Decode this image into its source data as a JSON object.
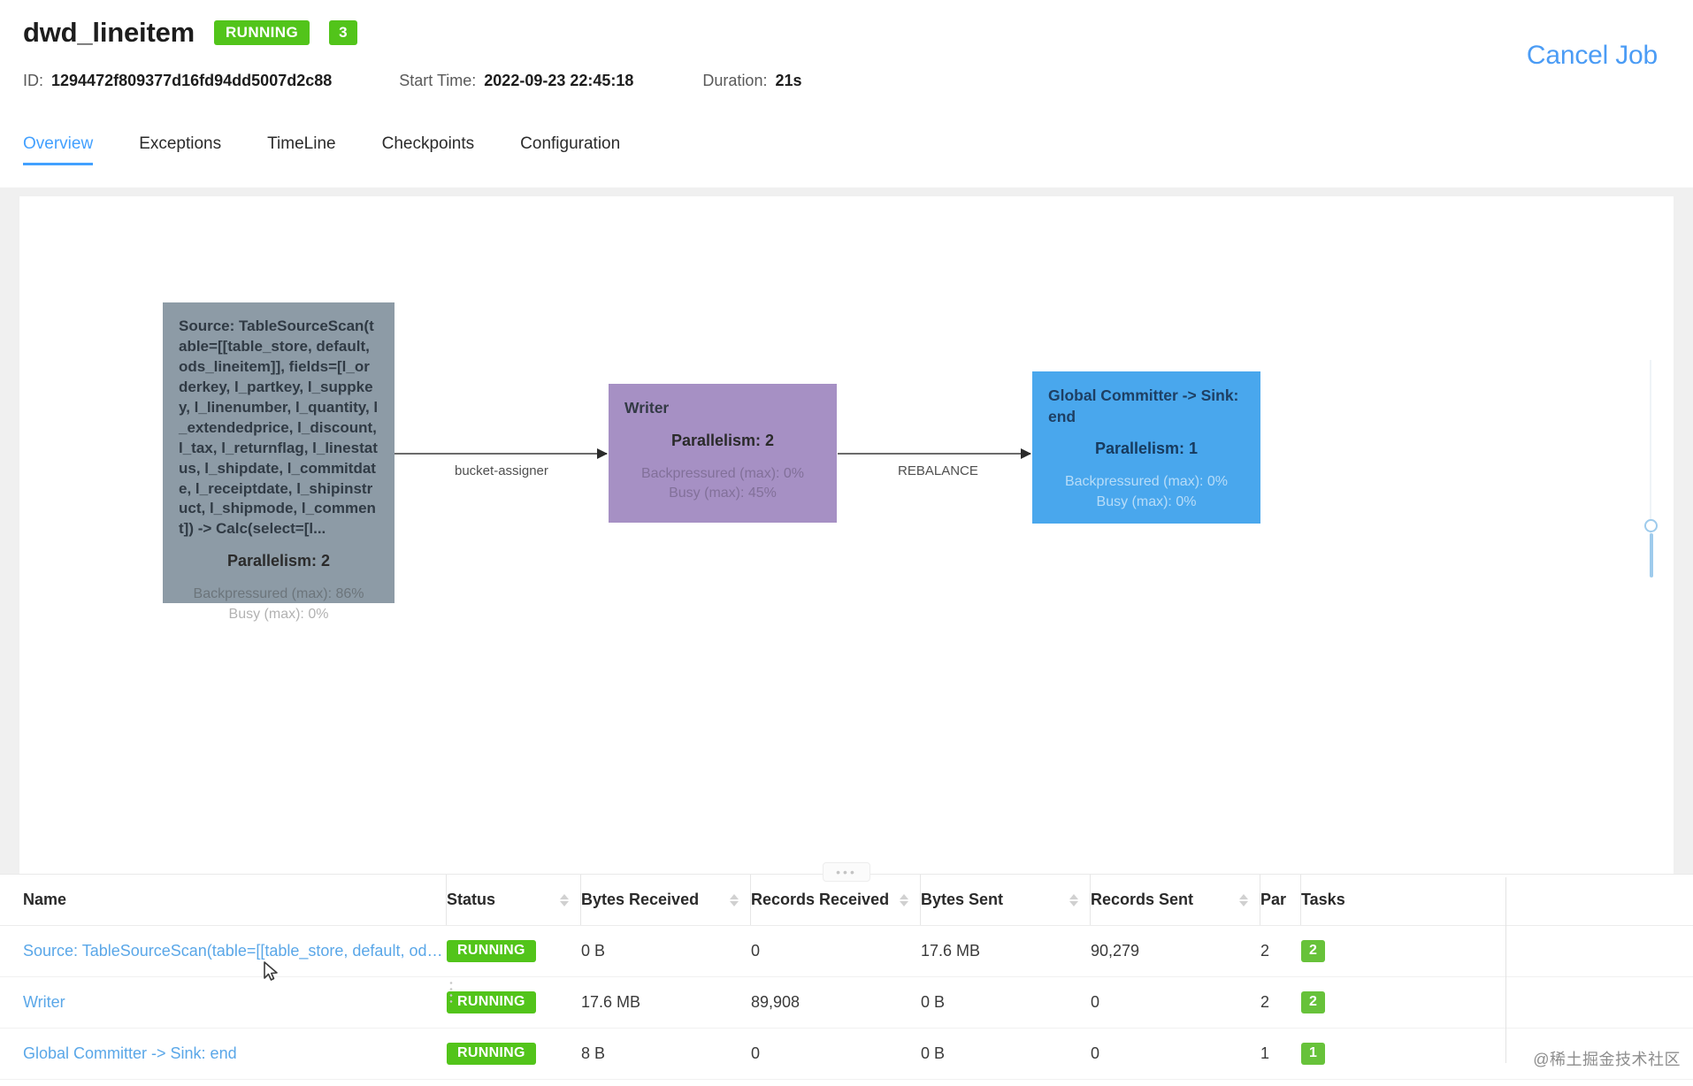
{
  "header": {
    "job_name": "dwd_lineitem",
    "status_badge": "RUNNING",
    "count_badge": "3",
    "id_label": "ID:",
    "id_value": "1294472f809377d16fd94dd5007d2c88",
    "start_time_label": "Start Time:",
    "start_time_value": "2022-09-23 22:45:18",
    "duration_label": "Duration:",
    "duration_value": "21s",
    "cancel_job": "Cancel Job",
    "accent_color": "#42a0ff",
    "status_color": "#52c41a"
  },
  "tabs": [
    {
      "label": "Overview",
      "active": true
    },
    {
      "label": "Exceptions",
      "active": false
    },
    {
      "label": "TimeLine",
      "active": false
    },
    {
      "label": "Checkpoints",
      "active": false
    },
    {
      "label": "Configuration",
      "active": false
    }
  ],
  "graph": {
    "nodes": [
      {
        "id": "source",
        "title": "Source: TableSourceScan(table=[[table_store, default, ods_lineitem]], fields=[l_orderkey, l_partkey, l_suppkey, l_linenumber, l_quantity, l_extendedprice, l_discount, l_tax, l_returnflag, l_linestatus, l_shipdate, l_commitdate, l_receiptdate, l_shipinstruct, l_shipmode, l_comment]) -> Calc(select=[l...",
        "parallelism": "Parallelism: 2",
        "backpressured": "Backpressured (max): 86%",
        "busy": "Busy (max): 0%",
        "color": "#8d9ba6"
      },
      {
        "id": "writer",
        "title": "Writer",
        "parallelism": "Parallelism: 2",
        "backpressured": "Backpressured (max): 0%",
        "busy": "Busy (max): 45%",
        "color": "#a690c4"
      },
      {
        "id": "sink",
        "title": "Global Committer -> Sink: end",
        "parallelism": "Parallelism: 1",
        "backpressured": "Backpressured (max): 0%",
        "busy": "Busy (max): 0%",
        "color": "#49a7ed"
      }
    ],
    "edges": [
      {
        "label": "bucket-assigner"
      },
      {
        "label": "REBALANCE"
      }
    ],
    "zoom_slider": {
      "name": "zoom-slider"
    }
  },
  "table": {
    "columns": [
      {
        "key": "name",
        "label": "Name",
        "sortable": false
      },
      {
        "key": "status",
        "label": "Status",
        "sortable": true
      },
      {
        "key": "bytes_received",
        "label": "Bytes Received",
        "sortable": true
      },
      {
        "key": "records_received",
        "label": "Records Received",
        "sortable": true
      },
      {
        "key": "bytes_sent",
        "label": "Bytes Sent",
        "sortable": true
      },
      {
        "key": "records_sent",
        "label": "Records Sent",
        "sortable": true
      },
      {
        "key": "parallelism",
        "label": "Par",
        "sortable": false
      },
      {
        "key": "tasks",
        "label": "Tasks",
        "sortable": false
      }
    ],
    "rows": [
      {
        "name": "Source: TableSourceScan(table=[[table_store, default, ods_lineit...",
        "status": "RUNNING",
        "bytes_received": "0 B",
        "records_received": "0",
        "bytes_sent": "17.6 MB",
        "records_sent": "90,279",
        "parallelism": "2",
        "tasks": "2"
      },
      {
        "name": "Writer",
        "status": "RUNNING",
        "bytes_received": "17.6 MB",
        "records_received": "89,908",
        "bytes_sent": "0 B",
        "records_sent": "0",
        "parallelism": "2",
        "tasks": "2"
      },
      {
        "name": "Global Committer -> Sink: end",
        "status": "RUNNING",
        "bytes_received": "8 B",
        "records_received": "0",
        "bytes_sent": "0 B",
        "records_sent": "0",
        "parallelism": "1",
        "tasks": "1"
      }
    ],
    "drag_handle": "•••"
  },
  "watermark": "@稀土掘金技术社区"
}
